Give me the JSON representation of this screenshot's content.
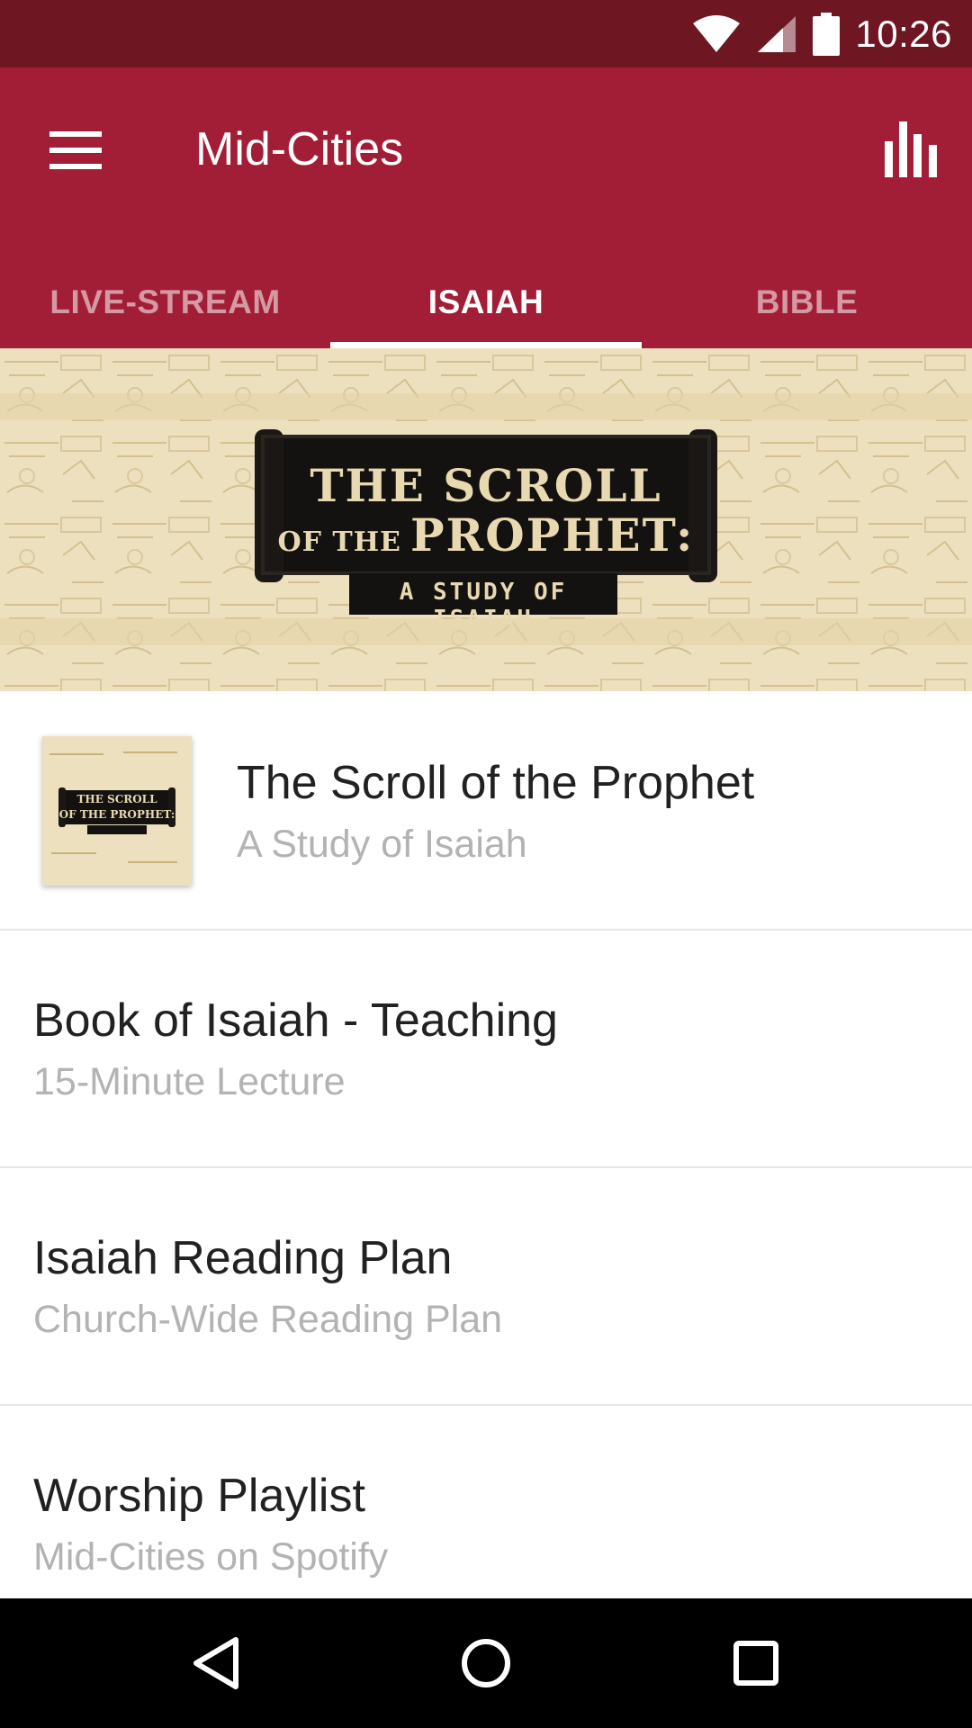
{
  "status_bar": {
    "time": "10:26",
    "icons": [
      "wifi-icon",
      "signal-icon",
      "battery-icon"
    ]
  },
  "app_bar": {
    "title": "Mid-Cities",
    "menu_icon": "hamburger-menu-icon",
    "action_icon": "bar-chart-icon"
  },
  "tabs": [
    {
      "label": "LIVE-STREAM",
      "active": false
    },
    {
      "label": "ISAIAH",
      "active": true
    },
    {
      "label": "BIBLE",
      "active": false
    }
  ],
  "banner": {
    "line1": "THE SCROLL",
    "line2_small": "OF THE",
    "line2_big": "PROPHET:",
    "subtitle": "A STUDY OF ISAIAH"
  },
  "list": [
    {
      "title": "The Scroll of the Prophet",
      "subtitle": "A Study of Isaiah",
      "has_thumbnail": true
    },
    {
      "title": "Book of Isaiah - Teaching",
      "subtitle": "15-Minute Lecture"
    },
    {
      "title": "Isaiah Reading Plan",
      "subtitle": "Church-Wide Reading Plan"
    },
    {
      "title": "Worship Playlist",
      "subtitle": "Mid-Cities on Spotify"
    }
  ],
  "nav_bar": {
    "buttons": [
      "back-icon",
      "home-icon",
      "recents-icon"
    ]
  },
  "colors": {
    "status_bar": "#6f1623",
    "app_bar": "#a21d36",
    "banner_paper": "#ede0bf"
  }
}
